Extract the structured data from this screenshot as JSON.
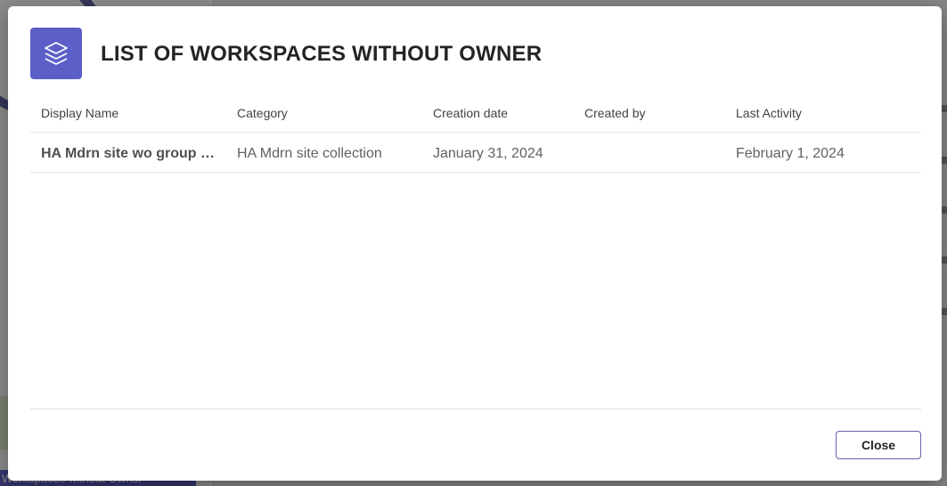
{
  "background": {
    "footer_tab_label": "Workspaces without Owner"
  },
  "dialog": {
    "title": "LIST OF WORKSPACES WITHOUT OWNER",
    "header_icon": "layers-icon",
    "accent_color": "#5b5fc7",
    "close_label": "Close"
  },
  "table": {
    "headers": {
      "display_name": "Display Name",
      "category": "Category",
      "creation_date": "Creation date",
      "created_by": "Created by",
      "last_activity": "Last Activity"
    },
    "rows": [
      {
        "display_name": "HA Mdrn site wo group o…",
        "category": "HA Mdrn site collection",
        "creation_date": "January 31, 2024",
        "created_by": "",
        "last_activity": "February 1, 2024"
      }
    ]
  }
}
